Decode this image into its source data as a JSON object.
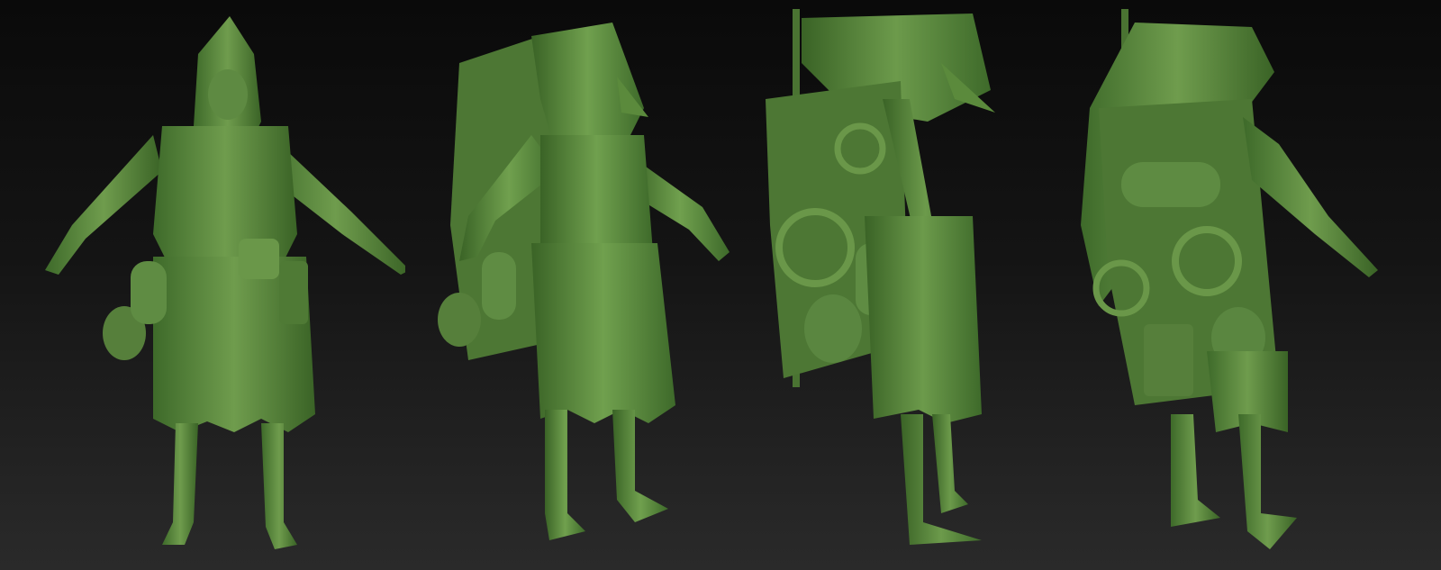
{
  "scene": {
    "subject": "sculpt-turnaround",
    "views": [
      {
        "id": "front"
      },
      {
        "id": "three-quarter"
      },
      {
        "id": "back-side"
      },
      {
        "id": "rear-three-quarter"
      }
    ]
  },
  "colors": {
    "background_top": "#0a0a0a",
    "background_bottom": "#2a2a2a",
    "clay_light": "#7fa85a",
    "clay_mid": "#5b8a3c",
    "clay_dark": "#2f4f20"
  }
}
